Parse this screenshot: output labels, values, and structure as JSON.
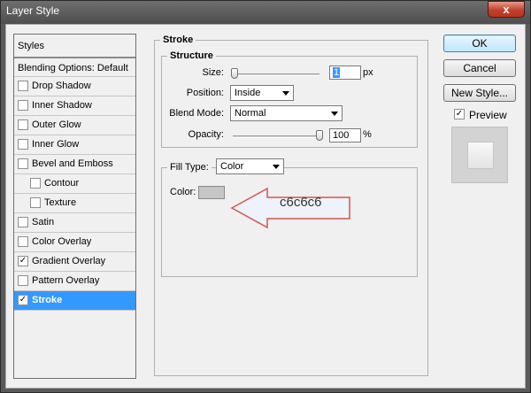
{
  "window": {
    "title": "Layer Style",
    "close_glyph": "x"
  },
  "styles_list": {
    "header": "Styles",
    "blending": "Blending Options: Default",
    "items": [
      {
        "label": "Drop Shadow",
        "checked": false,
        "indent": false,
        "selected": false
      },
      {
        "label": "Inner Shadow",
        "checked": false,
        "indent": false,
        "selected": false
      },
      {
        "label": "Outer Glow",
        "checked": false,
        "indent": false,
        "selected": false
      },
      {
        "label": "Inner Glow",
        "checked": false,
        "indent": false,
        "selected": false
      },
      {
        "label": "Bevel and Emboss",
        "checked": false,
        "indent": false,
        "selected": false
      },
      {
        "label": "Contour",
        "checked": false,
        "indent": true,
        "selected": false
      },
      {
        "label": "Texture",
        "checked": false,
        "indent": true,
        "selected": false
      },
      {
        "label": "Satin",
        "checked": false,
        "indent": false,
        "selected": false
      },
      {
        "label": "Color Overlay",
        "checked": false,
        "indent": false,
        "selected": false
      },
      {
        "label": "Gradient Overlay",
        "checked": true,
        "indent": false,
        "selected": false
      },
      {
        "label": "Pattern Overlay",
        "checked": false,
        "indent": false,
        "selected": false
      },
      {
        "label": "Stroke",
        "checked": true,
        "indent": false,
        "selected": true
      }
    ]
  },
  "buttons": {
    "ok": "OK",
    "cancel": "Cancel",
    "new_style": "New Style..."
  },
  "preview": {
    "label": "Preview",
    "checked": true
  },
  "stroke": {
    "section_title": "Stroke",
    "structure_title": "Structure",
    "size_label": "Size:",
    "size_value": "1",
    "size_unit": "px",
    "size_level": 0.0,
    "position_label": "Position:",
    "position_value": "Inside",
    "blend_label": "Blend Mode:",
    "blend_value": "Normal",
    "opacity_label": "Opacity:",
    "opacity_value": "100",
    "opacity_unit": "%",
    "opacity_level": 1.0,
    "fill_type_label": "Fill Type:",
    "fill_type_value": "Color",
    "color_label": "Color:",
    "color_hex": "#c6c6c6"
  },
  "callout": {
    "text": "c6c6c6"
  },
  "colors": {
    "selection": "#3399ff",
    "callout_border": "#d9534f",
    "callout_fill": "#eef3fb"
  }
}
